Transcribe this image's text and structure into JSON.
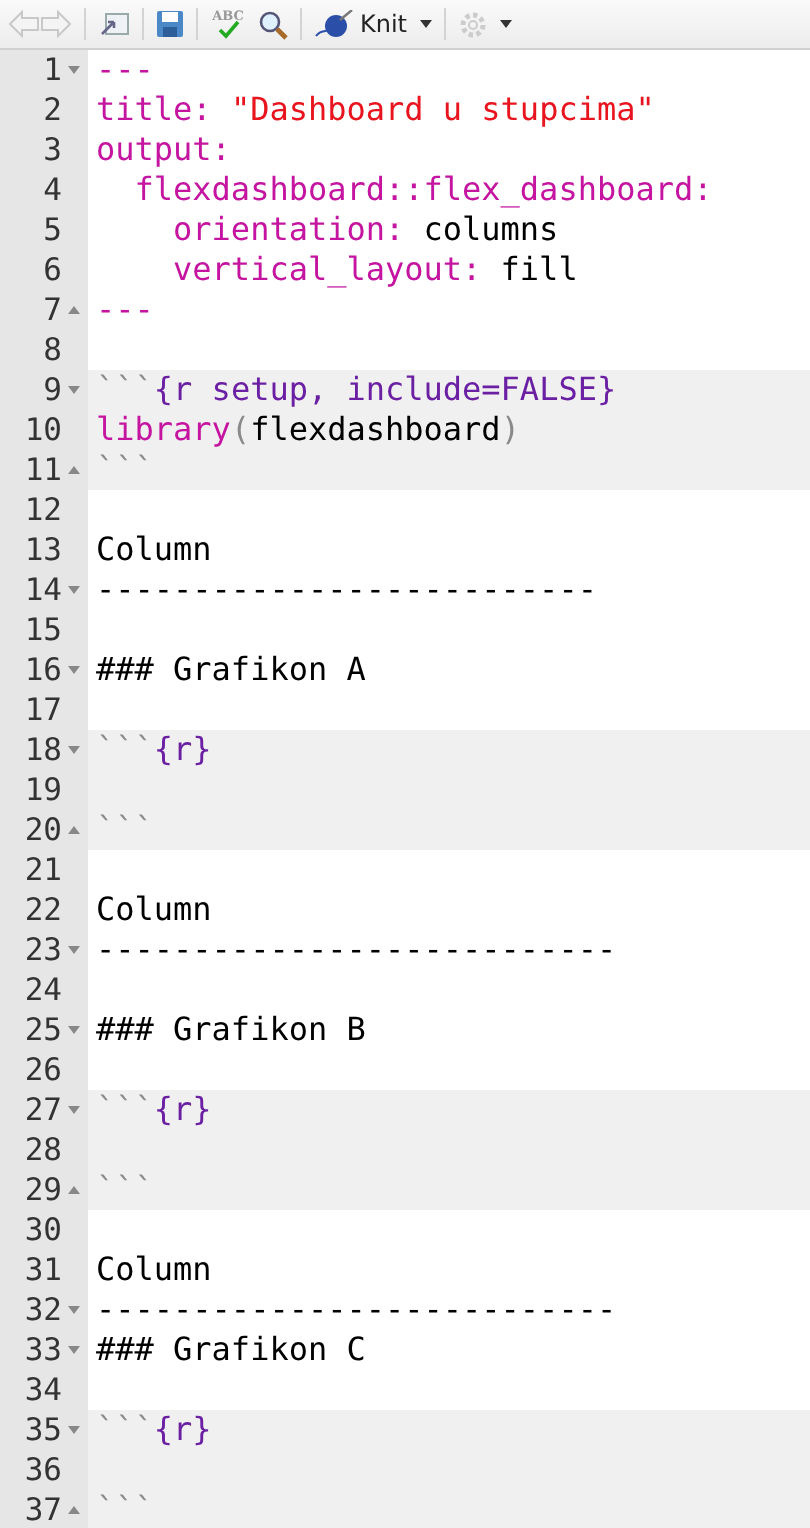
{
  "toolbar": {
    "back": {
      "disabled": true
    },
    "forward": {
      "disabled": true
    },
    "spellcheck_label": "ABC",
    "knit": {
      "label": "Knit"
    }
  },
  "editor": {
    "blocks": [
      {
        "kind": "text",
        "lines": [
          {
            "number": "1",
            "fold_start": true,
            "fold_end": false,
            "tokens": [
              {
                "text": "---",
                "kind": "keyword"
              }
            ]
          },
          {
            "number": "2",
            "fold_start": false,
            "fold_end": false,
            "tokens": [
              {
                "text": "title: ",
                "kind": "keyword"
              },
              {
                "text": "\"Dashboard u stupcima\"",
                "kind": "string"
              }
            ]
          },
          {
            "number": "3",
            "fold_start": false,
            "fold_end": false,
            "tokens": [
              {
                "text": "output:",
                "kind": "keyword"
              }
            ]
          },
          {
            "number": "4",
            "fold_start": false,
            "fold_end": false,
            "tokens": [
              {
                "text": "  flexdashboard::flex_dashboard:",
                "kind": "keyword"
              }
            ]
          },
          {
            "number": "5",
            "fold_start": false,
            "fold_end": false,
            "tokens": [
              {
                "text": "    orientation:",
                "kind": "keyword"
              },
              {
                "text": " columns",
                "kind": "plain"
              }
            ]
          },
          {
            "number": "6",
            "fold_start": false,
            "fold_end": false,
            "tokens": [
              {
                "text": "    vertical_layout:",
                "kind": "keyword"
              },
              {
                "text": " fill",
                "kind": "plain"
              }
            ]
          },
          {
            "number": "7",
            "fold_start": false,
            "fold_end": true,
            "tokens": [
              {
                "text": "---",
                "kind": "keyword"
              }
            ]
          },
          {
            "number": "8",
            "fold_start": false,
            "fold_end": false
          }
        ]
      },
      {
        "kind": "chunk",
        "lines": [
          {
            "number": "9",
            "fold_start": true,
            "fold_end": false,
            "tokens": [
              {
                "text": "```",
                "kind": "punct"
              },
              {
                "text": "{r setup, include=FALSE}",
                "kind": "header"
              }
            ]
          },
          {
            "number": "10",
            "fold_start": false,
            "fold_end": false,
            "tokens": [
              {
                "text": "library",
                "kind": "keyword"
              },
              {
                "text": "(",
                "kind": "punct"
              },
              {
                "text": "flexdashboard",
                "kind": "plain"
              },
              {
                "text": ")",
                "kind": "punct"
              }
            ]
          },
          {
            "number": "11",
            "fold_start": false,
            "fold_end": true,
            "tokens": [
              {
                "text": "```",
                "kind": "punct"
              }
            ]
          }
        ]
      },
      {
        "kind": "text",
        "lines": [
          {
            "number": "12",
            "fold_start": false,
            "fold_end": false
          },
          {
            "number": "13",
            "fold_start": false,
            "fold_end": false,
            "tokens": [
              {
                "text": "Column",
                "kind": "plain"
              }
            ]
          },
          {
            "number": "14",
            "fold_start": true,
            "fold_end": false,
            "tokens": [
              {
                "text": "--------------------------",
                "kind": "plain"
              }
            ]
          },
          {
            "number": "15",
            "fold_start": false,
            "fold_end": false
          },
          {
            "number": "16",
            "fold_start": true,
            "fold_end": false,
            "tokens": [
              {
                "text": "### Grafikon A",
                "kind": "plain"
              }
            ]
          },
          {
            "number": "17",
            "fold_start": false,
            "fold_end": false
          }
        ]
      },
      {
        "kind": "chunk",
        "lines": [
          {
            "number": "18",
            "fold_start": true,
            "fold_end": false,
            "tokens": [
              {
                "text": "```",
                "kind": "punct"
              },
              {
                "text": "{r}",
                "kind": "header"
              }
            ]
          },
          {
            "number": "19",
            "fold_start": false,
            "fold_end": false
          },
          {
            "number": "20",
            "fold_start": false,
            "fold_end": true,
            "tokens": [
              {
                "text": "```",
                "kind": "punct"
              }
            ]
          }
        ]
      },
      {
        "kind": "text",
        "lines": [
          {
            "number": "21",
            "fold_start": false,
            "fold_end": false
          },
          {
            "number": "22",
            "fold_start": false,
            "fold_end": false,
            "tokens": [
              {
                "text": "Column",
                "kind": "plain"
              }
            ]
          },
          {
            "number": "23",
            "fold_start": true,
            "fold_end": false,
            "tokens": [
              {
                "text": "---------------------------",
                "kind": "plain"
              }
            ]
          },
          {
            "number": "24",
            "fold_start": false,
            "fold_end": false
          },
          {
            "number": "25",
            "fold_start": true,
            "fold_end": false,
            "tokens": [
              {
                "text": "### Grafikon B",
                "kind": "plain"
              }
            ]
          },
          {
            "number": "26",
            "fold_start": false,
            "fold_end": false
          }
        ]
      },
      {
        "kind": "chunk",
        "lines": [
          {
            "number": "27",
            "fold_start": true,
            "fold_end": false,
            "tokens": [
              {
                "text": "```",
                "kind": "punct"
              },
              {
                "text": "{r}",
                "kind": "header"
              }
            ]
          },
          {
            "number": "28",
            "fold_start": false,
            "fold_end": false
          },
          {
            "number": "29",
            "fold_start": false,
            "fold_end": true,
            "tokens": [
              {
                "text": "```",
                "kind": "punct"
              }
            ]
          }
        ]
      },
      {
        "kind": "text",
        "lines": [
          {
            "number": "30",
            "fold_start": false,
            "fold_end": false
          },
          {
            "number": "31",
            "fold_start": false,
            "fold_end": false,
            "tokens": [
              {
                "text": "Column",
                "kind": "plain"
              }
            ]
          },
          {
            "number": "32",
            "fold_start": true,
            "fold_end": false,
            "tokens": [
              {
                "text": "---------------------------",
                "kind": "plain"
              }
            ]
          },
          {
            "number": "33",
            "fold_start": true,
            "fold_end": false,
            "tokens": [
              {
                "text": "### Grafikon C",
                "kind": "plain"
              }
            ]
          },
          {
            "number": "34",
            "fold_start": false,
            "fold_end": false
          }
        ]
      },
      {
        "kind": "chunk",
        "lines": [
          {
            "number": "35",
            "fold_start": true,
            "fold_end": false,
            "tokens": [
              {
                "text": "```",
                "kind": "punct"
              },
              {
                "text": "{r}",
                "kind": "header"
              }
            ]
          },
          {
            "number": "36",
            "fold_start": false,
            "fold_end": false
          },
          {
            "number": "37",
            "fold_start": false,
            "fold_end": true,
            "tokens": [
              {
                "text": "```",
                "kind": "punct"
              }
            ]
          }
        ]
      }
    ]
  }
}
